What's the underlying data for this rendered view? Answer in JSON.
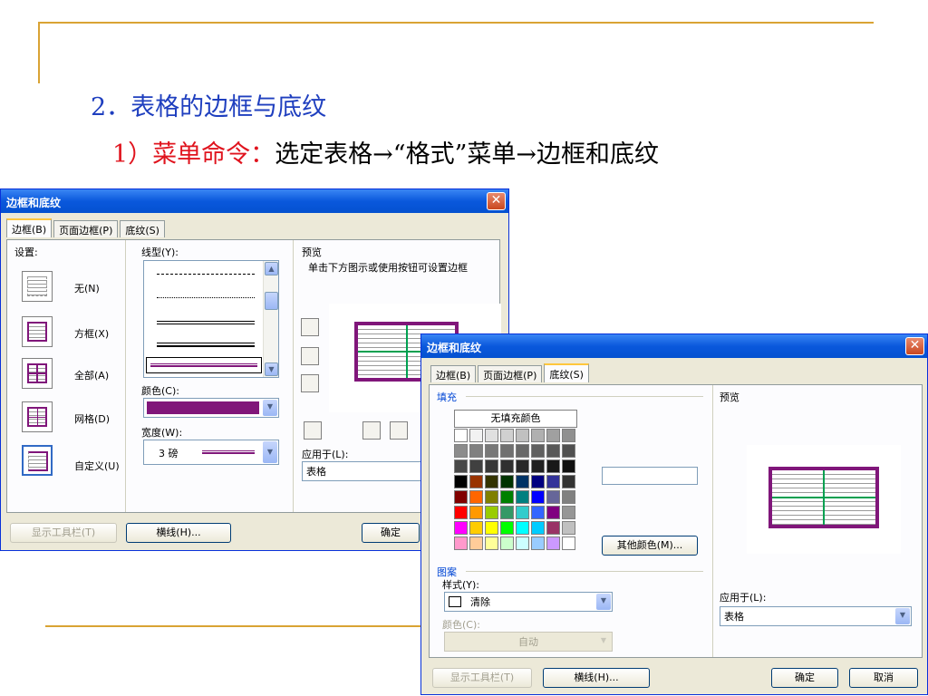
{
  "slide": {
    "heading": "2．表格的边框与底纹",
    "sub_red": "1）菜单命令：",
    "sub_black": "选定表格→“格式”菜单→边框和底纹"
  },
  "dialog1": {
    "title": "边框和底纹",
    "close_glyph": "✕",
    "tabs": [
      "边框(B)",
      "页面边框(P)",
      "底纹(S)"
    ],
    "settings_label": "设置:",
    "settings": [
      "无(N)",
      "方框(X)",
      "全部(A)",
      "网格(D)",
      "自定义(U)"
    ],
    "line_style_label": "线型(Y):",
    "color_label": "颜色(C):",
    "color_value": "#80167a",
    "width_label": "宽度(W):",
    "width_value": "3 磅",
    "preview_label": "预览",
    "preview_hint": "单击下方图示或使用按钮可设置边框",
    "apply_label": "应用于(L):",
    "apply_value": "表格",
    "btn_toolbar": "显示工具栏(T)",
    "btn_hline": "横线(H)...",
    "btn_ok": "确定"
  },
  "dialog2": {
    "title": "边框和底纹",
    "close_glyph": "✕",
    "tabs": [
      "边框(B)",
      "页面边框(P)",
      "底纹(S)"
    ],
    "fill_label": "填充",
    "no_fill": "无填充颜色",
    "more_colors": "其他颜色(M)...",
    "pattern_label": "图案",
    "style_label": "样式(Y):",
    "style_value": "清除",
    "color_label": "颜色(C):",
    "color_value": "自动",
    "preview_label": "预览",
    "apply_label": "应用于(L):",
    "apply_value": "表格",
    "btn_toolbar": "显示工具栏(T)",
    "btn_hline": "横线(H)...",
    "btn_ok": "确定",
    "btn_cancel": "取消",
    "palette": [
      [
        "#ffffff",
        "#f2f2f2",
        "#e0e0e0",
        "#d0d0d0",
        "#c0c0c0",
        "#b0b0b0",
        "#a0a0a0",
        "#909090"
      ],
      [
        "#8c8c8c",
        "#808080",
        "#787878",
        "#707070",
        "#686868",
        "#606060",
        "#585858",
        "#505050"
      ],
      [
        "#484848",
        "#404040",
        "#383838",
        "#303030",
        "#282828",
        "#202020",
        "#181818",
        "#101010"
      ],
      [
        "#000000",
        "#993300",
        "#333300",
        "#003300",
        "#003366",
        "#000080",
        "#333399",
        "#333333"
      ],
      [
        "#800000",
        "#ff6600",
        "#808000",
        "#008000",
        "#008080",
        "#0000ff",
        "#666699",
        "#808080"
      ],
      [
        "#ff0000",
        "#ff9900",
        "#99cc00",
        "#339966",
        "#33cccc",
        "#3366ff",
        "#800080",
        "#969696"
      ],
      [
        "#ff00ff",
        "#ffcc00",
        "#ffff00",
        "#00ff00",
        "#00ffff",
        "#00ccff",
        "#993366",
        "#c0c0c0"
      ],
      [
        "#ff99cc",
        "#ffcc99",
        "#ffff99",
        "#ccffcc",
        "#ccffff",
        "#99ccff",
        "#cc99ff",
        "#ffffff"
      ]
    ]
  }
}
